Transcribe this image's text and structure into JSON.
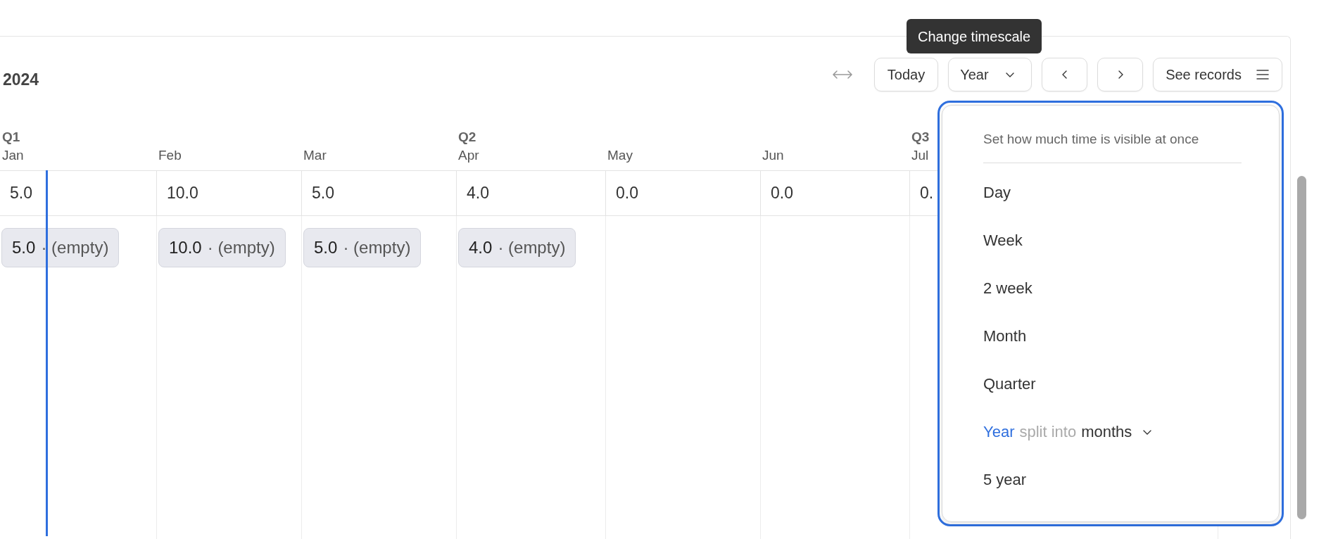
{
  "title": "2024",
  "toolbar": [
    {
      "kind": "resize"
    },
    {
      "kind": "button",
      "label": "Today"
    },
    {
      "kind": "select",
      "label": "Year"
    },
    {
      "kind": "prev"
    },
    {
      "kind": "next"
    },
    {
      "kind": "menu",
      "label": "See records"
    }
  ],
  "tooltip": {
    "text": "Change timescale"
  },
  "columns": [
    {
      "quarter": "Q1",
      "month": "Jan",
      "total": "5.0",
      "today": true,
      "chip": {
        "value": "5.0",
        "note": "· (empty)"
      }
    },
    {
      "month": "Feb",
      "total": "10.0",
      "today": false,
      "chip": {
        "value": "10.0",
        "note": "· (empty)"
      }
    },
    {
      "month": "Mar",
      "total": "5.0",
      "today": false,
      "chip": {
        "value": "5.0",
        "note": "· (empty)"
      }
    },
    {
      "quarter": "Q2",
      "month": "Apr",
      "total": "4.0",
      "today": false,
      "chip": {
        "value": "4.0",
        "note": "· (empty)"
      }
    },
    {
      "month": "May",
      "total": "0.0",
      "today": false
    },
    {
      "month": "Jun",
      "total": "0.0",
      "today": false
    },
    {
      "quarter": "Q3",
      "month": "Jul",
      "total": "0.",
      "today": false
    }
  ],
  "timescale_menu": {
    "description": "Set how much time is visible at once",
    "options": [
      {
        "kind": "plain",
        "label": "Day",
        "selected": false
      },
      {
        "kind": "plain",
        "label": "Week",
        "selected": false
      },
      {
        "kind": "plain",
        "label": "2 week",
        "selected": false
      },
      {
        "kind": "plain",
        "label": "Month",
        "selected": false
      },
      {
        "kind": "plain",
        "label": "Quarter",
        "selected": false
      },
      {
        "kind": "split",
        "label": "Year",
        "joiner": "split into",
        "unit": "months",
        "selected": true
      },
      {
        "kind": "plain",
        "label": "5 year",
        "selected": false
      }
    ]
  }
}
